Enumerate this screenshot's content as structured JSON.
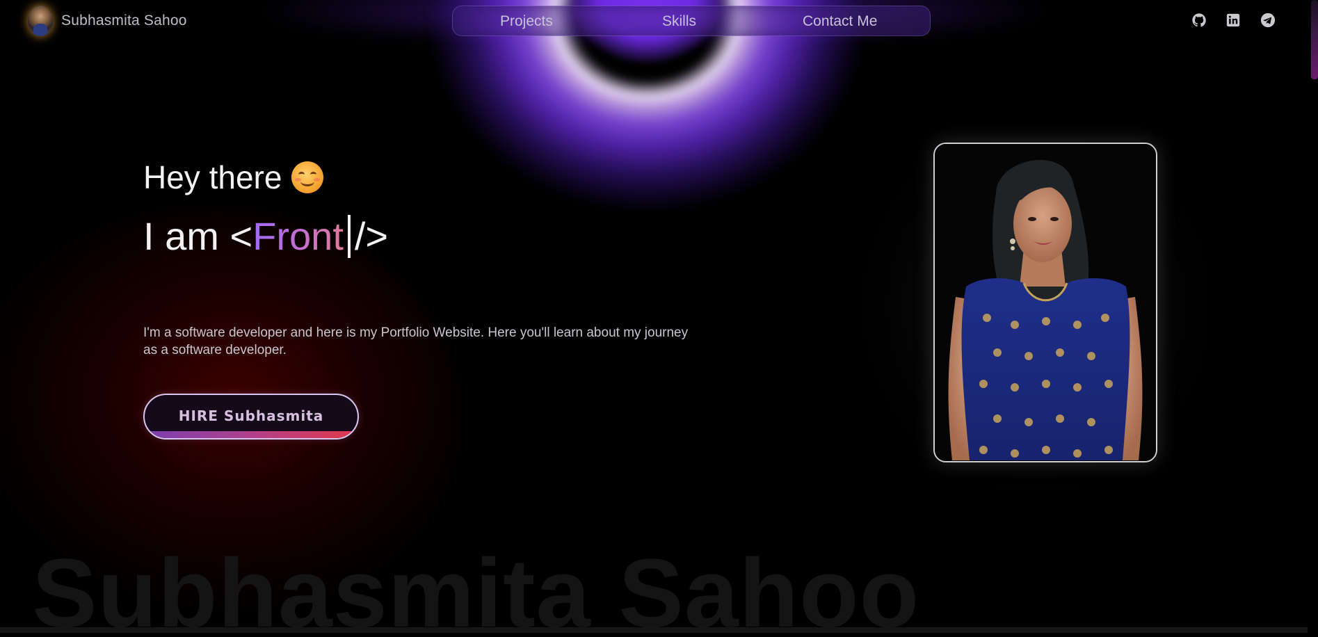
{
  "header": {
    "brand_name": "Subhasmita Sahoo",
    "avatar_icon": "profile-avatar",
    "nav": [
      {
        "label": "Projects"
      },
      {
        "label": "Skills"
      },
      {
        "label": "Contact Me"
      }
    ],
    "social_icons": [
      "github-icon",
      "linkedin-icon",
      "telegram-icon"
    ]
  },
  "hero": {
    "greeting": "Hey there",
    "greeting_emoji": "smiling-face-icon",
    "iam_prefix": "I am <",
    "typed_text": "Front",
    "iam_suffix": "/>",
    "bio": "I'm a software developer and here is my Portfolio Website. Here you'll learn about my journey as a software developer.",
    "hire_button": "HIRE Subhasmita"
  },
  "watermark": "Subhasmita Sahoo",
  "colors": {
    "background": "#000000",
    "purple_glow": "#6b2ae0",
    "red_glow": "#6e0000",
    "typed_gradient_start": "#9d6cf5",
    "typed_gradient_end": "#e47a9a",
    "button_border": "#d9c6ee",
    "button_bar_start": "#7a3fb0",
    "button_bar_end": "#e03a4a"
  }
}
